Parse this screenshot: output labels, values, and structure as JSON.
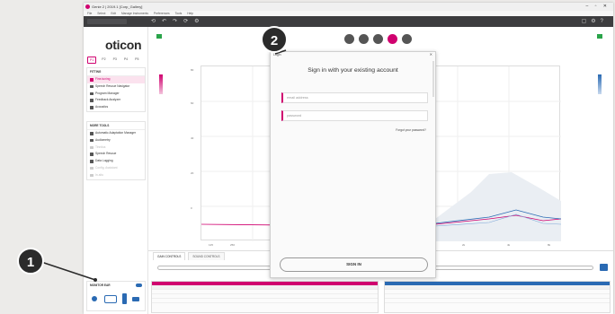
{
  "window": {
    "title": "Genie 2 | 2019.1 [Corp_Gallery]",
    "controls": "– ▫ ✕",
    "menu": [
      "File",
      "Select",
      "Edit",
      "Manage Instruments",
      "Preferences",
      "Tools",
      "Help"
    ]
  },
  "brand": {
    "logo": "oticon",
    "accent": "#d0006f",
    "blue": "#2a6ab3"
  },
  "sidebar": {
    "tabs": [
      "P1",
      "P2",
      "P3",
      "P4",
      "P5"
    ],
    "fitting": {
      "header": "FITTING",
      "items": [
        "Fine-tuning",
        "Speech Rescue Navigator",
        "Program Manager",
        "Feedback Analyzer",
        "Acoustics"
      ]
    },
    "more_tools": {
      "header": "MORE TOOLS",
      "items": [
        "Automatic Adaptation Manager",
        "Audiometry",
        "Tinnitus",
        "Speech Rescue",
        "Data Logging",
        "Config. Assistant",
        "In-situ"
      ]
    },
    "monitor": {
      "label": "MONITOR EAR"
    }
  },
  "graph": {
    "y_ticks": [
      "80",
      "60",
      "40",
      "20",
      "0"
    ],
    "x_ticks": [
      "125",
      "250",
      "500",
      "1k",
      "2k",
      "4k",
      "8k"
    ]
  },
  "bottom": {
    "tabs": [
      "GAIN CONTROLS",
      "SOUND CONTROLS"
    ]
  },
  "dialog": {
    "title": "Login",
    "close": "✕",
    "heading": "Sign in with your existing account",
    "email_placeholder": "email address",
    "password_placeholder": "password",
    "forgot": "Forgot your password?",
    "signin": "SIGN IN"
  },
  "callouts": {
    "one": "1",
    "two": "2"
  }
}
